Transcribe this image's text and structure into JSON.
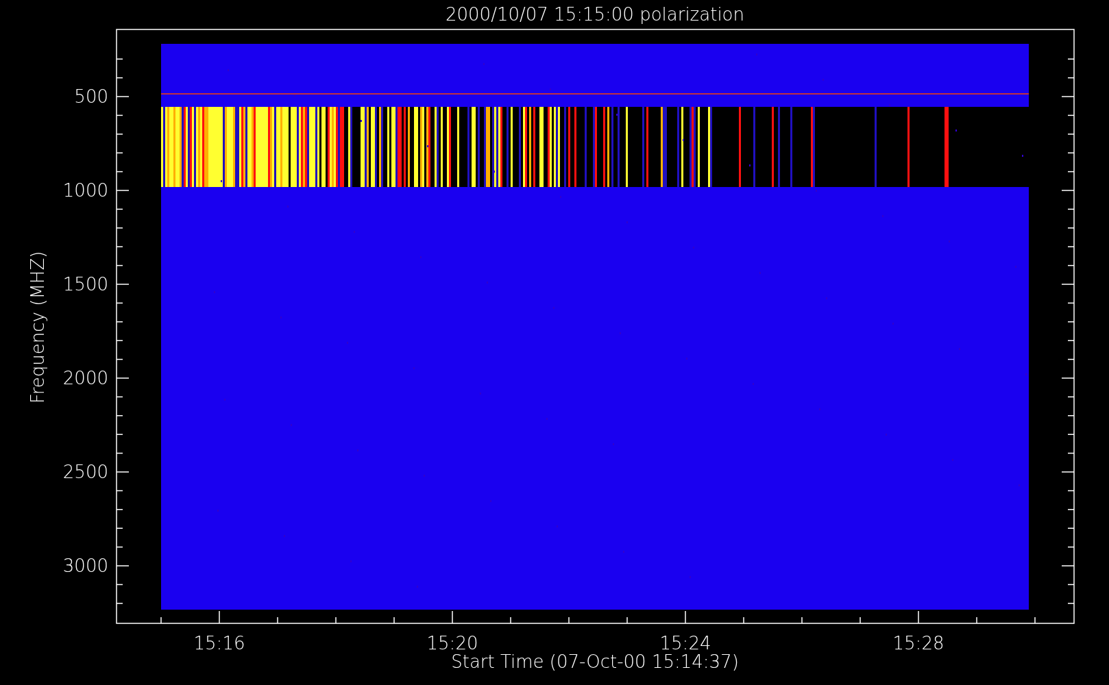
{
  "title": "2000/10/07 15:15:00 polarization",
  "xlabel": "Start Time (07-Oct-00 15:14:37)",
  "ylabel": "Frequency (MHZ)",
  "xticks": [
    "15:16",
    "15:20",
    "15:24",
    "15:28"
  ],
  "yticks": [
    "500",
    "1000",
    "1500",
    "2000",
    "2500",
    "3000"
  ]
}
